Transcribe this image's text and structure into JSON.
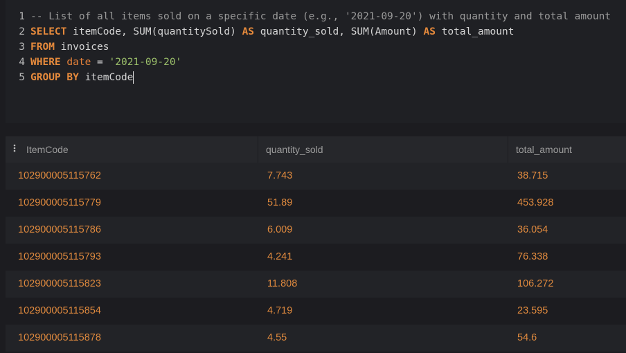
{
  "editor": {
    "lines": [
      {
        "num": "1",
        "tokens": [
          {
            "cls": "cmt",
            "text": "-- List of all items sold on a specific date (e.g., '2021-09-20') with quantity and total amount"
          }
        ]
      },
      {
        "num": "2",
        "tokens": [
          {
            "cls": "kw",
            "text": "SELECT"
          },
          {
            "cls": "plain",
            "text": " itemCode, SUM(quantitySold) "
          },
          {
            "cls": "kw",
            "text": "AS"
          },
          {
            "cls": "plain",
            "text": " quantity_sold, SUM(Amount) "
          },
          {
            "cls": "kw",
            "text": "AS"
          },
          {
            "cls": "plain",
            "text": " total_amount"
          }
        ]
      },
      {
        "num": "3",
        "tokens": [
          {
            "cls": "kw",
            "text": "FROM"
          },
          {
            "cls": "plain",
            "text": " invoices"
          }
        ]
      },
      {
        "num": "4",
        "tokens": [
          {
            "cls": "kw",
            "text": "WHERE"
          },
          {
            "cls": "id",
            "text": " date"
          },
          {
            "cls": "plain",
            "text": " = "
          },
          {
            "cls": "str",
            "text": "'2021-09-20'"
          }
        ]
      },
      {
        "num": "5",
        "tokens": [
          {
            "cls": "kw",
            "text": "GROUP BY"
          },
          {
            "cls": "plain",
            "text": " itemCode"
          }
        ]
      }
    ]
  },
  "results": {
    "columns": [
      "ItemCode",
      "quantity_sold",
      "total_amount"
    ],
    "rows": [
      [
        "102900005115762",
        "7.743",
        "38.715"
      ],
      [
        "102900005115779",
        "51.89",
        "453.928"
      ],
      [
        "102900005115786",
        "6.009",
        "36.054"
      ],
      [
        "102900005115793",
        "4.241",
        "76.338"
      ],
      [
        "102900005115823",
        "11.808",
        "106.272"
      ],
      [
        "102900005115854",
        "4.719",
        "23.595"
      ],
      [
        "102900005115878",
        "4.55",
        "54.6"
      ]
    ]
  },
  "icons": {
    "column_menu": "vertical-dots-icon"
  },
  "colors": {
    "keyword": "#e68a3c",
    "string": "#9bbf6a",
    "comment": "#9a9a9a",
    "cell_value": "#e08a3e",
    "header_text": "#9c9c9c"
  }
}
